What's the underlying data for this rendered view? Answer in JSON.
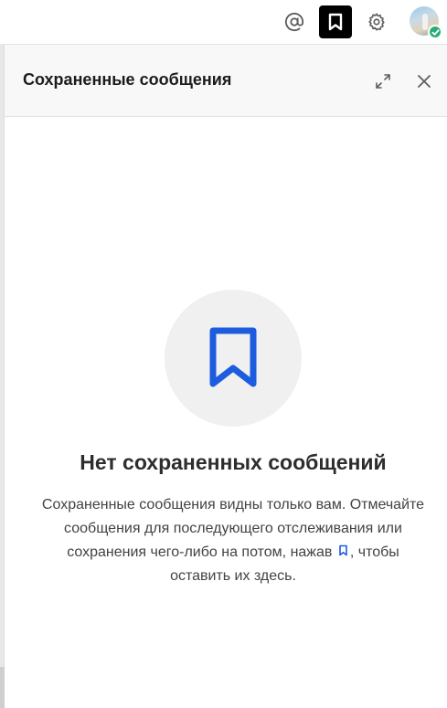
{
  "topbar": {
    "icons": [
      "at-icon",
      "bookmark-icon",
      "gear-icon"
    ],
    "active": "bookmark-icon",
    "presence_status": "active"
  },
  "panel": {
    "title": "Сохраненные сообщения"
  },
  "empty_state": {
    "title": "Нет сохраненных сообщений",
    "desc_part1": "Сохраненные сообщения видны только вам. Отмечайте сообщения для последующего отслеживания или сохранения чего-либо на потом, нажав",
    "desc_part2": ", чтобы оставить их здесь."
  },
  "colors": {
    "accent_blue": "#1d5cde",
    "presence_green": "#2bac76",
    "header_bg": "#f8f8f8"
  }
}
